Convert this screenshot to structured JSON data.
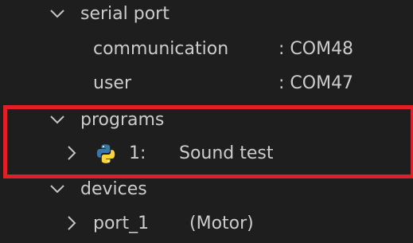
{
  "tree": {
    "serial_port": {
      "label": "serial port",
      "communication_label": "communication",
      "communication_value": ": COM48",
      "user_label": "user",
      "user_value": ": COM47"
    },
    "programs": {
      "label": "programs",
      "items": [
        {
          "index": "1:",
          "name": "Sound test",
          "icon": "python-icon"
        }
      ]
    },
    "devices": {
      "label": "devices",
      "items": [
        {
          "name": "port_1",
          "type": "(Motor)"
        }
      ]
    }
  },
  "colors": {
    "background": "#1e1e1e",
    "text": "#cccccc",
    "highlight": "#e21e26",
    "python_blue": "#3776ab",
    "python_yellow": "#ffd43b"
  }
}
